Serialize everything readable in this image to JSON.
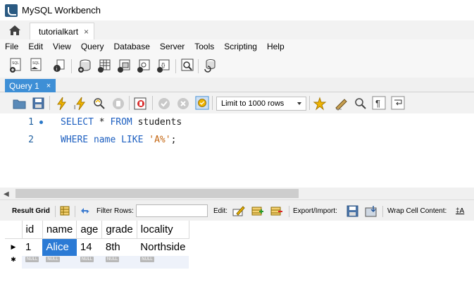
{
  "window": {
    "title": "MySQL Workbench"
  },
  "connection_tab": {
    "label": "tutorialkart",
    "close": "×"
  },
  "menu": [
    "File",
    "Edit",
    "View",
    "Query",
    "Database",
    "Server",
    "Tools",
    "Scripting",
    "Help"
  ],
  "editor_tab": {
    "label": "Query 1",
    "close": "×"
  },
  "limit_select": {
    "value": "Limit to 1000 rows"
  },
  "editor": {
    "lines": [
      {
        "number": "1",
        "tokens": [
          {
            "t": "SELECT",
            "c": "kw"
          },
          {
            "t": " * ",
            "c": "id"
          },
          {
            "t": "FROM",
            "c": "kw"
          },
          {
            "t": " students",
            "c": "id"
          }
        ]
      },
      {
        "number": "2",
        "tokens": [
          {
            "t": "WHERE",
            "c": "kw"
          },
          {
            "t": " name ",
            "c": "kw"
          },
          {
            "t": "LIKE",
            "c": "kw"
          },
          {
            "t": " ",
            "c": "id"
          },
          {
            "t": "'A%'",
            "c": "str"
          },
          {
            "t": ";",
            "c": "id"
          }
        ]
      }
    ]
  },
  "result_toolbar": {
    "result_grid": "Result Grid",
    "filter_rows": "Filter Rows:",
    "filter_value": "",
    "edit": "Edit:",
    "export_import": "Export/Import:",
    "wrap_cell": "Wrap Cell Content:",
    "wrap_icon": "‡A"
  },
  "grid": {
    "columns": [
      "id",
      "name",
      "age",
      "grade",
      "locality"
    ],
    "rows": [
      [
        "1",
        "Alice",
        "14",
        "8th",
        "Northside"
      ]
    ],
    "null_label": "NULL",
    "row_marker": "▶",
    "new_row_marker": "✱"
  },
  "colors": {
    "accent": "#3e8fd6",
    "selection": "#2a7ad5",
    "keyword": "#1d5fc0",
    "string": "#c46510"
  }
}
